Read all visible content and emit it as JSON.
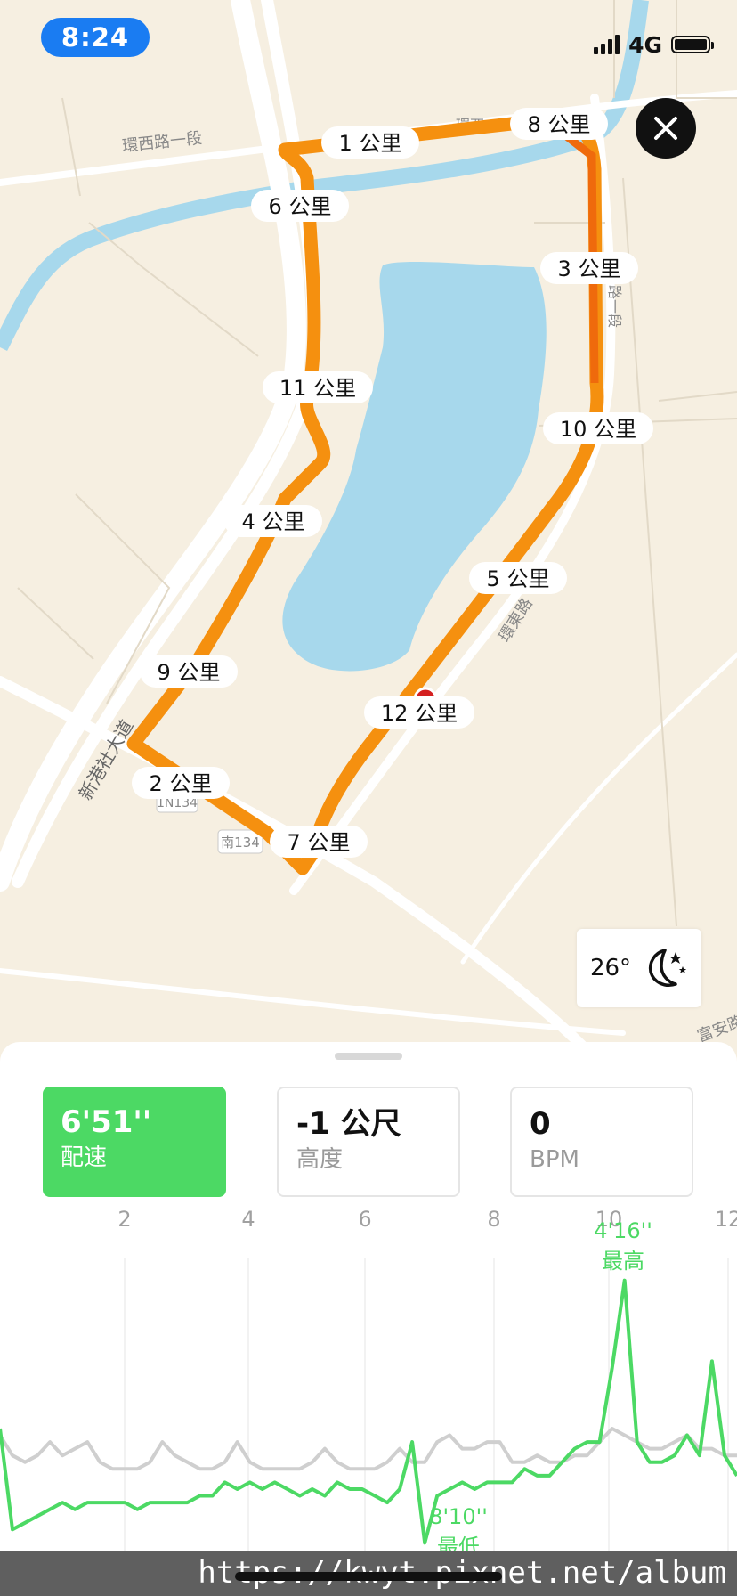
{
  "status": {
    "time": "8:24",
    "network": "4G"
  },
  "map": {
    "streets": [
      "環西路一段",
      "環東路",
      "環西",
      "新港社大道",
      "路一段"
    ],
    "road_badges": [
      "1N134",
      "南134"
    ],
    "bottom_text": "富安路"
  },
  "km_markers": [
    "1 公里",
    "8 公里",
    "6 公里",
    "3 公里",
    "11 公里",
    "10 公里",
    "4 公里",
    "5 公里",
    "9 公里",
    "12 公里",
    "2 公里",
    "7 公里"
  ],
  "weather": {
    "temp": "26°",
    "icon": "moon-stars-icon"
  },
  "metrics": [
    {
      "value": "6'51''",
      "label": "配速"
    },
    {
      "value": "-1 公尺",
      "label": "高度"
    },
    {
      "value": "0",
      "label": "BPM"
    }
  ],
  "chart_data": {
    "type": "line",
    "x_ticks": [
      "2",
      "4",
      "6",
      "8",
      "10",
      "12"
    ],
    "series": [
      {
        "color": "#4cd964",
        "values": [
          6.5,
          8.0,
          7.9,
          7.8,
          7.7,
          7.6,
          7.7,
          7.6,
          7.6,
          7.6,
          7.6,
          7.7,
          7.6,
          7.6,
          7.6,
          7.6,
          7.5,
          7.5,
          7.3,
          7.4,
          7.3,
          7.4,
          7.3,
          7.4,
          7.5,
          7.4,
          7.5,
          7.3,
          7.4,
          7.4,
          7.5,
          7.6,
          7.4,
          6.7,
          8.2,
          7.5,
          7.4,
          7.3,
          7.4,
          7.3,
          7.3,
          7.3,
          7.1,
          7.2,
          7.2,
          7.0,
          6.8,
          6.7,
          6.7,
          5.6,
          4.3,
          6.7,
          7.0,
          7.0,
          6.9,
          6.6,
          6.9,
          5.5,
          6.9,
          7.2
        ]
      },
      {
        "color": "#cfcfcf",
        "values": [
          6.6,
          6.9,
          7.0,
          6.9,
          6.7,
          6.9,
          6.8,
          6.7,
          7.0,
          7.1,
          7.1,
          7.1,
          7.0,
          6.7,
          6.9,
          7.0,
          7.1,
          7.1,
          7.0,
          6.7,
          7.0,
          7.1,
          7.1,
          7.1,
          7.1,
          7.0,
          6.8,
          7.0,
          7.1,
          7.1,
          7.1,
          7.0,
          6.8,
          7.0,
          7.0,
          6.7,
          6.6,
          6.8,
          6.8,
          6.7,
          6.7,
          7.0,
          7.0,
          6.9,
          7.0,
          7.0,
          6.9,
          6.9,
          6.7,
          6.5,
          6.6,
          6.7,
          6.8,
          6.8,
          6.7,
          6.6,
          6.8,
          6.8,
          6.9,
          6.9
        ]
      }
    ],
    "annotations": [
      {
        "value": "4'16''",
        "label": "最高",
        "color": "#4cd964"
      },
      {
        "value": "8'10''",
        "label": "最低",
        "color": "#4cd964"
      }
    ]
  },
  "watermark": "https://kwyt.pixnet.net/album"
}
